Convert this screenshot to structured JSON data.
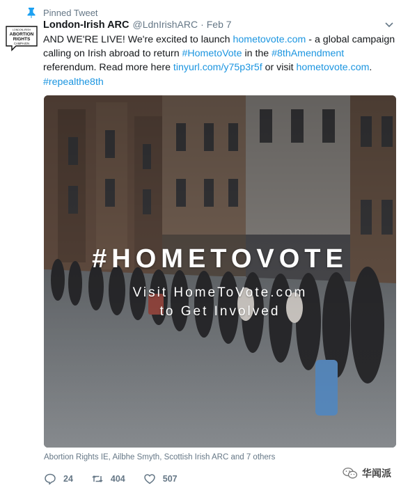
{
  "pinned": {
    "label": "Pinned Tweet",
    "icon": "pin-icon"
  },
  "account": {
    "avatar_lines": [
      "LONDON-IRISH",
      "ABORTION",
      "RIGHTS",
      "CAMPAIGN"
    ],
    "name": "London-Irish ARC",
    "handle": "@LdnIrishARC",
    "separator": "·",
    "date": "Feb 7"
  },
  "tweet": {
    "l1a": "AND WE'RE LIVE! We're excited to launch ",
    "l1_link": "hometovote.com",
    "l1b": " - a global campaign",
    "l2a": "calling on Irish abroad to return ",
    "l2_tag1": "#HometoVote",
    "l2b": " in the ",
    "l2_tag2": "#8thAmendment",
    "l3a": "referendum. Read more here ",
    "l3_link1": "tinyurl.com/y75p3r5f",
    "l3b": " or visit ",
    "l3_link2": "hometovote.com",
    "l3c": ".",
    "l4_tag": "#repealthe8th"
  },
  "media": {
    "headline": "#HOMETOVOTE",
    "line1": "Visit HomeToVote.com",
    "line2": "to Get Involved"
  },
  "liked_by": "Abortion Rights IE, Ailbhe Smyth, Scottish Irish ARC and 7 others",
  "actions": {
    "replies": "24",
    "retweets": "404",
    "likes": "507"
  },
  "watermark": {
    "text": "华闻派"
  },
  "colors": {
    "link": "#1b95e0",
    "muted": "#657786",
    "pin": "#1da1f2"
  }
}
